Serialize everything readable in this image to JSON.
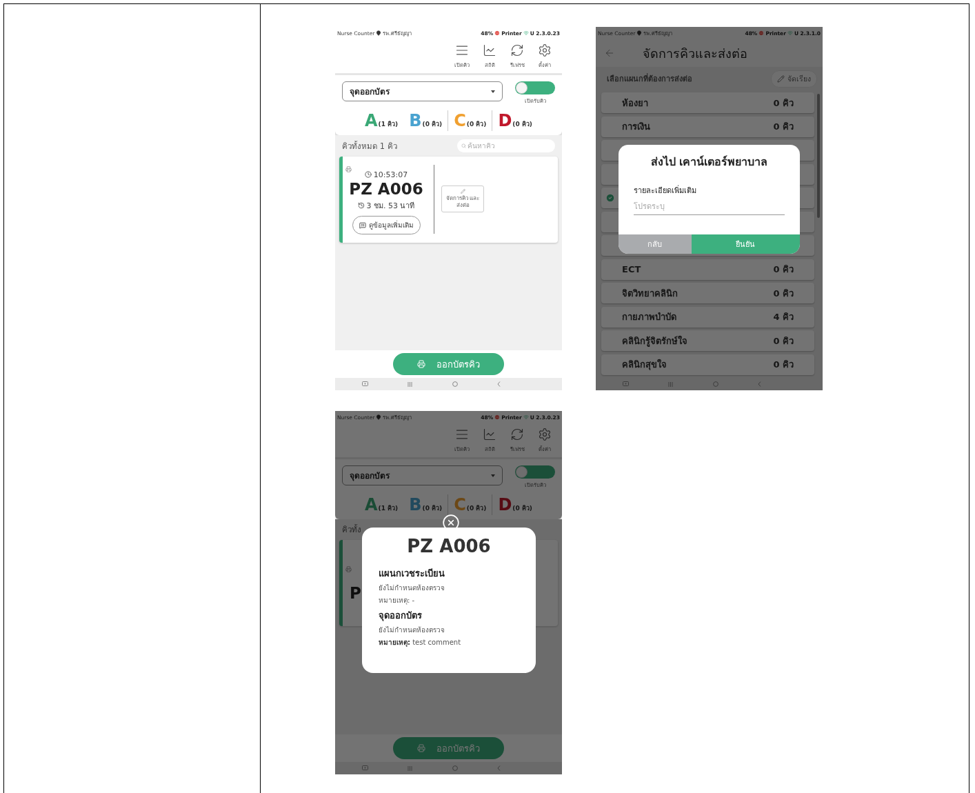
{
  "screens": [
    {
      "kind": "queue",
      "status_bar": {
        "app": "Nurse Counter",
        "location": "รพ.ศรีธัญญา",
        "battery": "48%",
        "printer": "Printer",
        "version": "U 2.3.0.23"
      },
      "nav_items": [
        {
          "label": "เปิดคิว"
        },
        {
          "label": "สถิติ"
        },
        {
          "label": "รีเฟรช"
        },
        {
          "label": "ตั้งค่า"
        }
      ],
      "station_select": {
        "value": "จุดออกบัตร"
      },
      "intake_toggle": {
        "label": "เปิดรับคิว",
        "on": true
      },
      "queue_groups": [
        {
          "letter": "A",
          "count": "(1 คิว)",
          "color": "#3aa876"
        },
        {
          "letter": "B",
          "count": "(0 คิว)",
          "color": "#4aa3d0"
        },
        {
          "letter": "C",
          "count": "(0 คิว)",
          "color": "#f0a030"
        },
        {
          "letter": "D",
          "count": "(0 คิว)",
          "color": "#c0182b"
        }
      ],
      "list": {
        "total_label": "คิวทั้งหมด 1 คิว",
        "search_placeholder": "ค้นหาคิว",
        "cards": [
          {
            "time": "10:53:07",
            "number": "PZ A006",
            "waited": "3 ชม. 53 นาที",
            "details_button": "ดูข้อมูลเพิ่มเติม",
            "action_button": "จัดการคิว และส่งต่อ"
          }
        ]
      },
      "issue_button": "ออกบัตรคิว"
    },
    {
      "kind": "transfer",
      "status_bar": {
        "app": "Nurse Counter",
        "location": "รพ.ศรีธัญญา",
        "battery": "48%",
        "printer": "Printer",
        "version": "U 2.3.1.0"
      },
      "title": "จัดการคิวและส่งต่อ",
      "subtitle": "เลือกแผนกที่ต้องการส่งต่อ",
      "sort_button": "จัดเรียง",
      "departments": [
        {
          "name": "ห้องยา",
          "count": "0 คิว",
          "selected": false
        },
        {
          "name": "การเงิน",
          "count": "0 คิว",
          "selected": false
        },
        {
          "selected": false
        },
        {
          "selected": false
        },
        {
          "selected": true
        },
        {
          "selected": false
        },
        {
          "selected": false
        },
        {
          "name": "ECT",
          "count": "0 คิว",
          "selected": false
        },
        {
          "name": "จิตวิทยาคลินิก",
          "count": "0 คิว",
          "selected": false
        },
        {
          "name": "กายภาพบำบัด",
          "count": "4 คิว",
          "selected": false
        },
        {
          "name": "คลินิกรู้จิตรักษ์ใจ",
          "count": "0 คิว",
          "selected": false
        },
        {
          "name": "คลินิกสุขใจ",
          "count": "0 คิว",
          "selected": false
        }
      ],
      "dialog": {
        "title": "ส่งไป เคาน์เตอร์พยาบาล",
        "field_label": "รายละเอียดเพิ่มเติม",
        "placeholder": "โปรดระบุ",
        "buttons": [
          {
            "label": "กลับ",
            "kind": "cancel"
          },
          {
            "label": "ยืนยัน",
            "kind": "confirm"
          }
        ]
      }
    },
    {
      "kind": "queue",
      "status_bar": {
        "app": "Nurse Counter",
        "location": "รพ.ศรีธัญญา",
        "battery": "48%",
        "printer": "Printer",
        "version": "U 2.3.0.23"
      },
      "nav_items": [
        {
          "label": "เปิดคิว"
        },
        {
          "label": "สถิติ"
        },
        {
          "label": "รีเฟรช"
        },
        {
          "label": "ตั้งค่า"
        }
      ],
      "station_select": {
        "value": "จุดออกบัตร"
      },
      "intake_toggle": {
        "label": "เปิดรับคิว",
        "on": true
      },
      "queue_groups": [
        {
          "letter": "A",
          "count": "(1 คิว)",
          "color": "#1a4c35"
        },
        {
          "letter": "B",
          "count": "(0 คิว)",
          "color": "#214a5e"
        },
        {
          "letter": "C",
          "count": "(0 คิว)",
          "color": "#6c4816"
        },
        {
          "letter": "D",
          "count": "(0 คิว)",
          "color": "#570b13"
        }
      ],
      "list": {
        "total_label": "คิวทั้ง",
        "cards": [
          {
            "number": "P"
          }
        ]
      },
      "issue_button": "ออกบัตรคิว",
      "detail": {
        "title": "PZ A006",
        "sections": [
          {
            "heading": "แผนกเวชระเบียน",
            "room": "ยังไม่กำหนดห้องตรวจ",
            "note": "หมายเหตุ: -"
          },
          {
            "heading": "จุดออกบัตร",
            "room": "ยังไม่กำหนดห้องตรวจ",
            "note": "**หมายเหตุ:** test comment"
          }
        ]
      }
    }
  ]
}
